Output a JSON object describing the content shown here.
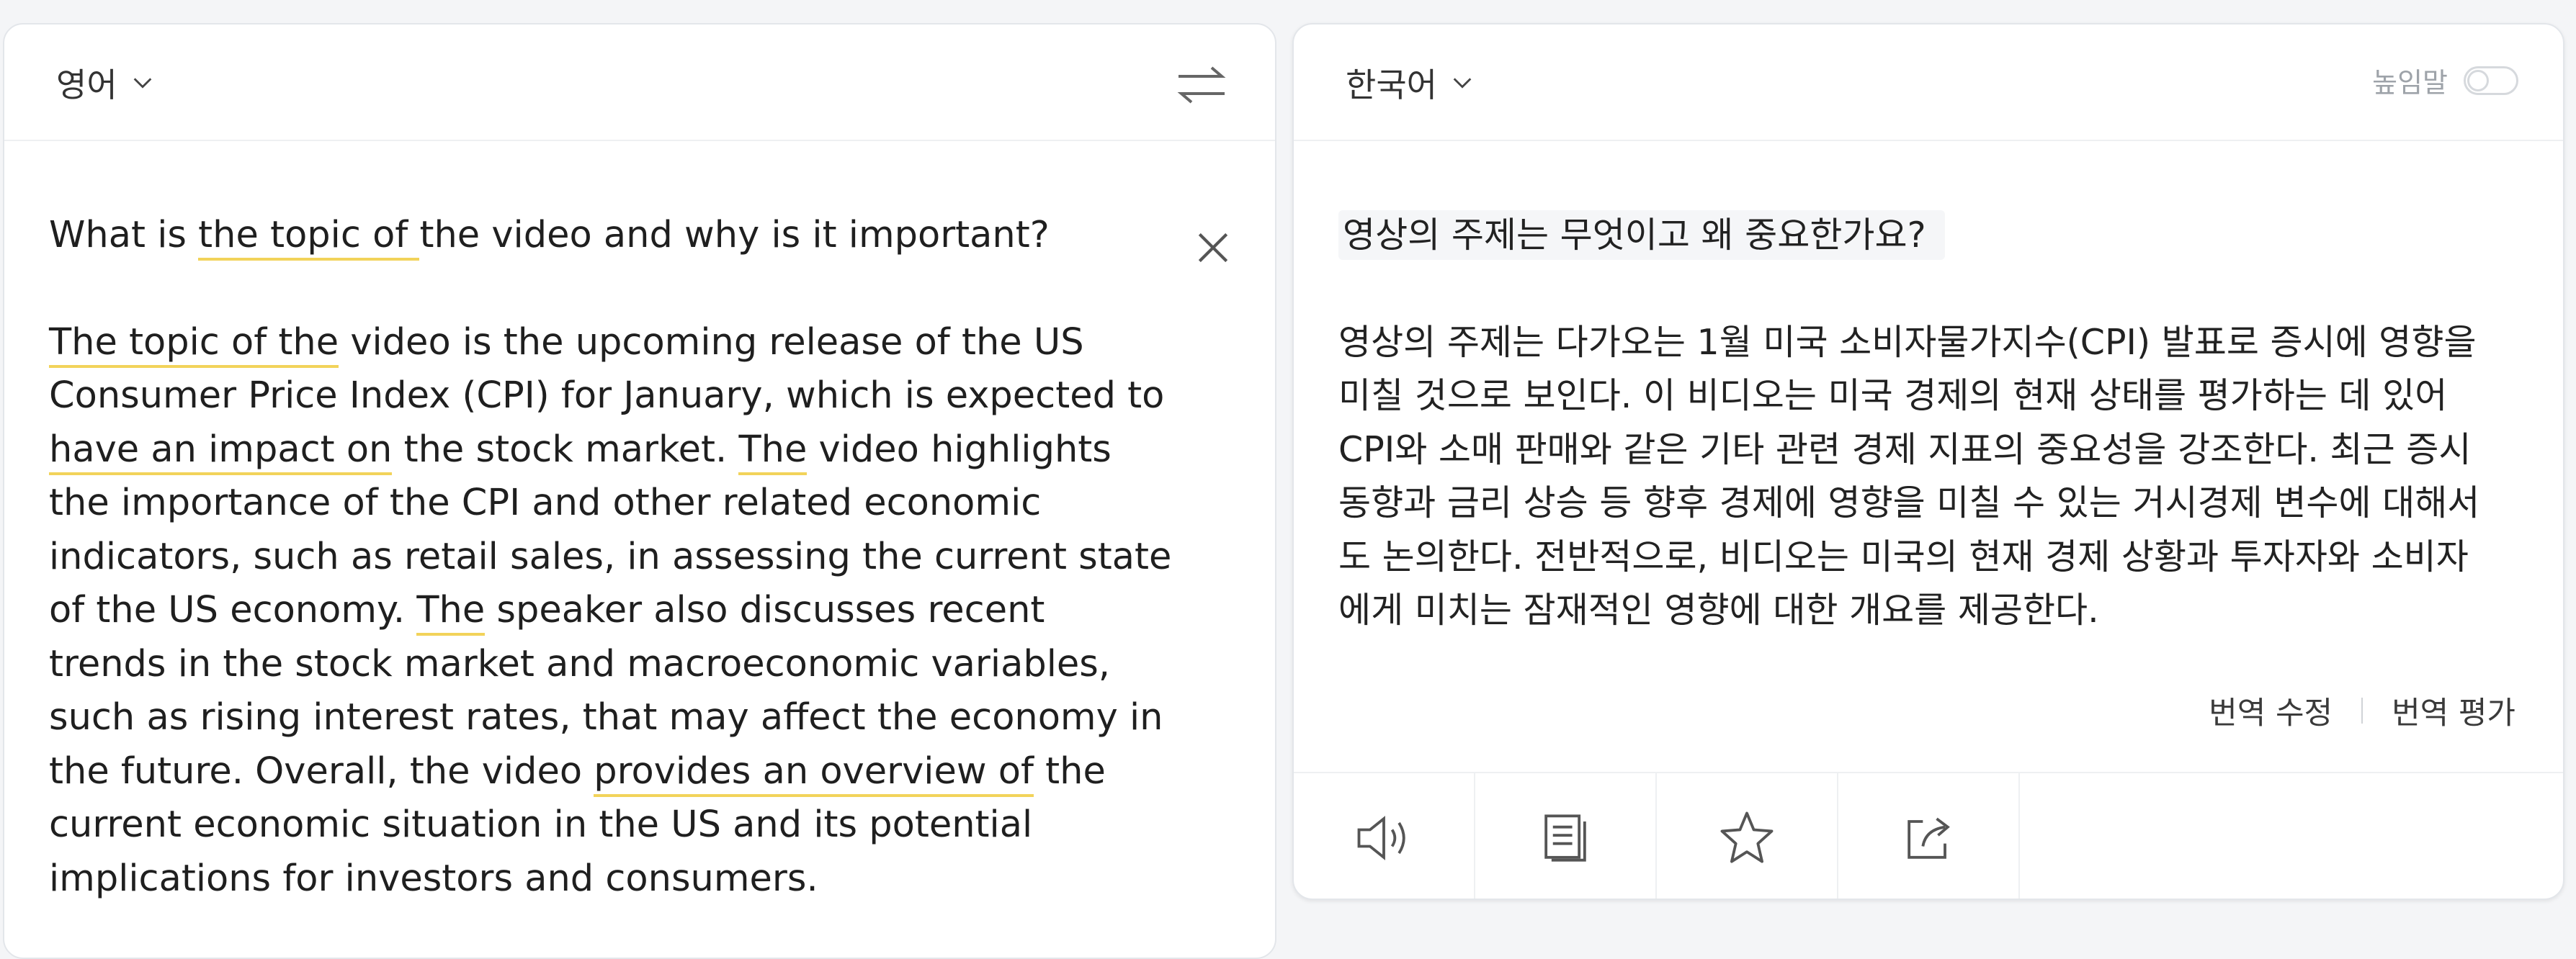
{
  "source": {
    "language": "영어",
    "question": [
      {
        "t": "What is ",
        "hl": false
      },
      {
        "t": "the topic of ",
        "hl": true
      },
      {
        "t": "the video and why is it important?",
        "hl": false
      }
    ],
    "body": [
      {
        "t": "The topic of the",
        "hl": true
      },
      {
        "t": " video is the upcoming release of the US Consumer Price Index (CPI) for January, which is expected to ",
        "hl": false
      },
      {
        "t": "have an impact on",
        "hl": true
      },
      {
        "t": " the stock market. ",
        "hl": false
      },
      {
        "t": "The",
        "hl": true
      },
      {
        "t": " video highlights the importance of the CPI and other related economic indicators, such as retail sales, in assessing the current state of the US economy. ",
        "hl": false
      },
      {
        "t": "The",
        "hl": true
      },
      {
        "t": " speaker also discusses recent trends in the stock market and macroeconomic variables, such as rising interest rates, that may affect the economy in the future. Overall, the video ",
        "hl": false
      },
      {
        "t": "provides an overview of",
        "hl": true
      },
      {
        "t": " the current economic situation in the US and its potential implications for investors and consumers.",
        "hl": false
      }
    ]
  },
  "target": {
    "language": "한국어",
    "honorific_label": "높임말",
    "honorific_on": false,
    "question": "영상의 주제는 무엇이고 왜 중요한가요?",
    "body": "영상의 주제는 다가오는 1월 미국 소비자물가지수(CPI) 발표로 증시에 영향을 미칠 것으로 보인다. 이 비디오는 미국 경제의 현재 상태를 평가하는 데 있어 CPI와 소매 판매와 같은 기타 관련 경제 지표의 중요성을 강조한다. 최근 증시 동향과 금리 상승 등 향후 경제에 영향을 미칠 수 있는 거시경제 변수에 대해서도 논의한다. 전반적으로, 비디오는 미국의 현재 경제 상황과 투자자와 소비자에게 미치는 잠재적인 영향에 대한 개요를 제공한다.",
    "actions": {
      "edit": "번역 수정",
      "rate": "번역 평가"
    }
  },
  "toolbar": [
    "speaker-icon",
    "copy-icon",
    "star-icon",
    "share-icon"
  ],
  "colors": {
    "highlight": "#f2d35a",
    "border": "#e3e6ea"
  }
}
